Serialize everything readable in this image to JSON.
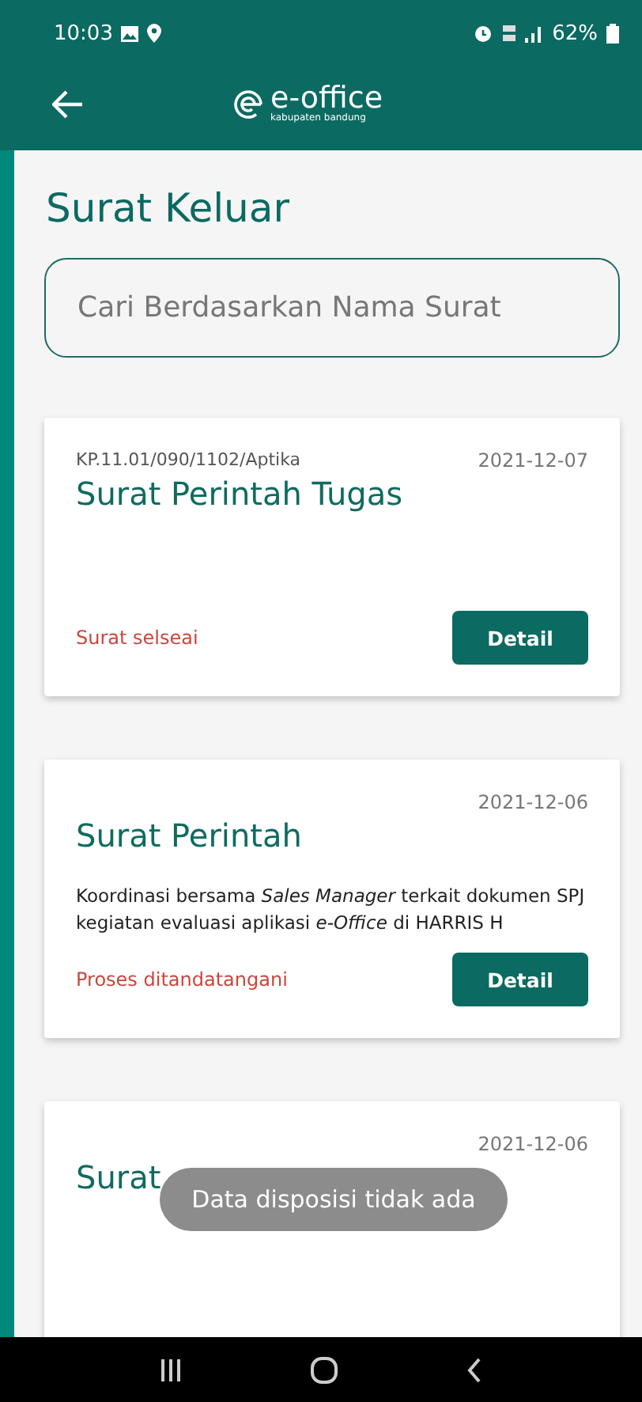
{
  "status_bar": {
    "time": "10:03",
    "battery": "62%"
  },
  "header": {
    "logo_text": "e-office",
    "logo_subtext": "kabupaten bandung"
  },
  "page_title": "Surat Keluar",
  "search": {
    "placeholder": "Cari Berdasarkan Nama Surat"
  },
  "letters": [
    {
      "number": "KP.11.01/090/1102/Aptika",
      "date": "2021-12-07",
      "title": "Surat Perintah Tugas",
      "status": "Surat selseai",
      "button": "Detail"
    },
    {
      "date": "2021-12-06",
      "title": "Surat Perintah",
      "description": "Koordinasi bersama *Sales Manager* terkait dokumen SPJ kegiatan evaluasi aplikasi *e-Office* di HARRIS H",
      "status": "Proses ditandatangani",
      "button": "Detail"
    },
    {
      "date": "2021-12-06",
      "title": "Surat"
    }
  ],
  "toast": "Data disposisi tidak ada"
}
